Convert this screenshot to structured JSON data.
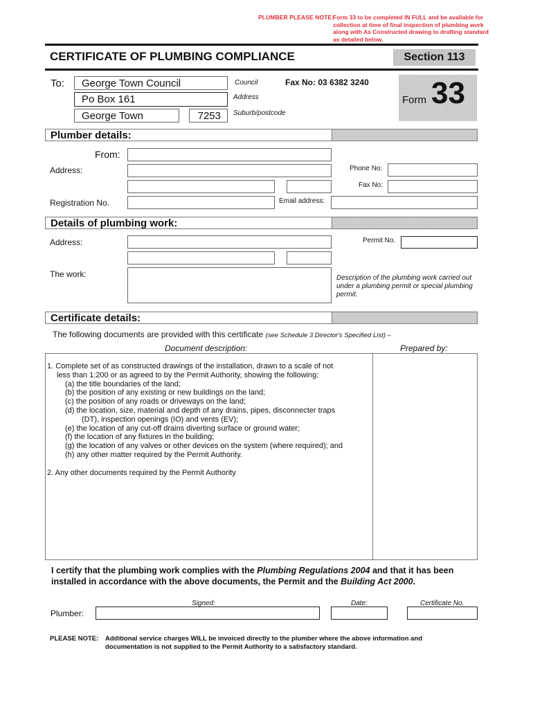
{
  "header_note": {
    "label": "PLUMBER PLEASE NOTE:",
    "text": "Form 33 to be completed IN FULL and be available for collection at time of final inspection of plumbing work along with As Constructed drawing to drafting standard as detailed below.",
    "color": "#e0303a"
  },
  "title": "CERTIFICATE OF PLUMBING COMPLIANCE",
  "section_badge": "Section 113",
  "form_badge": {
    "word": "Form",
    "number": "33"
  },
  "to_block": {
    "to_label": "To:",
    "council_value": "George Town Council",
    "council_caption": "Council",
    "address_value": "Po Box 161",
    "address_caption": "Address",
    "suburb_value": "George Town",
    "postcode_value": "7253",
    "suburb_caption": "Suburb/postcode",
    "fax": "Fax No: 03 6382 3240"
  },
  "plumber_details": {
    "heading": "Plumber details:",
    "from_label": "From:",
    "address_label": "Address:",
    "phone_label": "Phone No:",
    "fax_label": "Fax No:",
    "registration_label": "Registration No.",
    "email_label": "Email address:",
    "from_value": "",
    "address_line1": "",
    "address_line2": "",
    "postcode": "",
    "phone": "",
    "fax": "",
    "registration": "",
    "email": ""
  },
  "work_details": {
    "heading": "Details of plumbing work:",
    "address_label": "Address:",
    "permit_label": "Permit No.",
    "work_label": "The work:",
    "work_hint": "Description of the plumbing work carried out under a plumbing permit or special plumbing permit.",
    "address_line1": "",
    "address_line2": "",
    "postcode": "",
    "permit_no": "",
    "work_description": ""
  },
  "certificate_details": {
    "heading": "Certificate details:",
    "intro": "The following documents are provided with this certificate",
    "intro_ref": "(see Schedule 3 Director's Specified List) –",
    "col_description": "Document description:",
    "col_prepared": "Prepared by:",
    "documents": [
      "1. Complete set of as constructed drawings of the installation, drawn to a scale of  not",
      "less than 1:200 or as agreed to by the Permit Authority, showing the following:",
      "(a) the title boundaries of the land;",
      "(b) the position of any existing or new buildings on the land;",
      "(c) the position of any roads or driveways on the land;",
      "(d) the location, size, material and depth of any drains, pipes, disconnecter traps",
      "(DT), inspection openings (IO) and vents (EV);",
      "(e) the location of any cut-off drains diverting surface or ground water;",
      "(f) the location of any fixtures in the building;",
      "(g) the location of any valves or other devices on the system (where required); and",
      "(h) any other matter required by the Permit Authority.",
      "2. Any other documents required by the Permit Authority"
    ]
  },
  "certification": {
    "p1": "I certify that the plumbing work complies with the ",
    "p2": "Plumbing Regulations 2004",
    "p3": " and that it has been installed in accordance with the above documents, the Permit and the ",
    "p4": "Building Act 2000",
    "p5": "."
  },
  "signature": {
    "plumber_label": "Plumber:",
    "signed_caption": "Signed:",
    "date_caption": "Date:",
    "cert_caption": "Certificate No.",
    "signed": "",
    "date": "",
    "certificate_no": ""
  },
  "footer_note": {
    "label": "PLEASE NOTE:",
    "text1": "Additional service charges WILL be invoiced directly to the plumber where the above information and",
    "text2": "documentation is not supplied to the Permit Authority to a satisfactory standard."
  }
}
